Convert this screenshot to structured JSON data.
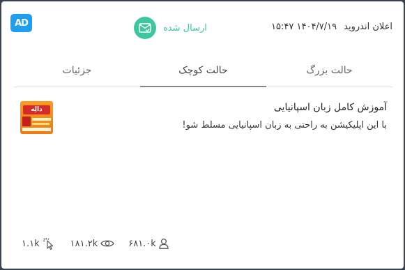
{
  "app": {
    "logo_text": "AD"
  },
  "header": {
    "title": "اعلان اندروید",
    "datetime": "۱۴۰۴/۷/۱۹ ۱۵:۴۷",
    "status_label": "ارسال شده",
    "status_color": "#3ec6a0"
  },
  "tabs": [
    {
      "label": "حالت بزرگ",
      "active": false
    },
    {
      "label": "حالت کوچک",
      "active": true
    },
    {
      "label": "جزئیات",
      "active": false
    }
  ],
  "ad": {
    "title": "آموزش کامل زبان اسپانیایی",
    "description": "با این اپلیکیشن به راحتی به زبان اسپانیایی مسلط شو!",
    "thumbnail_text": "دالِه"
  },
  "stats": {
    "clicks": "۱.۱k",
    "views": "۱۸۱.۲k",
    "users": "۶۸۱.۰k"
  }
}
